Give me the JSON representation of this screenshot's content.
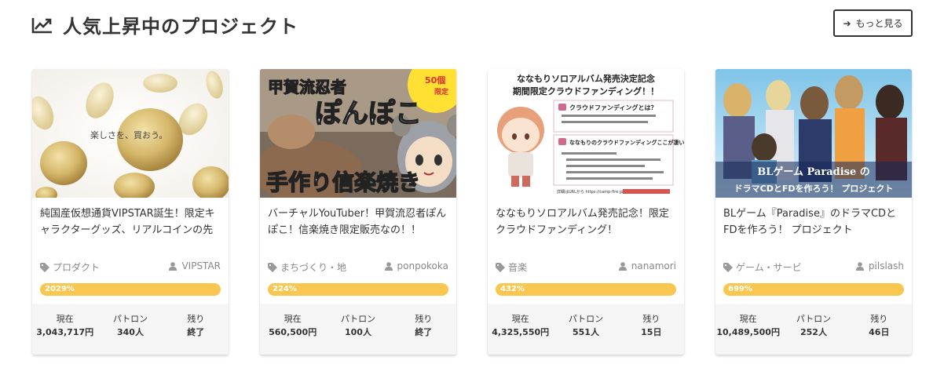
{
  "header": {
    "title": "人気上昇中のプロジェクト",
    "more_label": "もっと見る"
  },
  "labels": {
    "current": "現在",
    "patron": "パトロン",
    "remaining": "残り"
  },
  "projects": [
    {
      "image_text": "楽しさを、買おう。",
      "title": "純国産仮想通貨VIPSTAR誕生！限定キャラクターグッズ、リアルコインの先行販売",
      "category": "プロダクト",
      "owner": "VIPSTAR",
      "progress": "2029%",
      "current": "3,043,717円",
      "patrons": "340人",
      "remaining": "終了"
    },
    {
      "image_text": "甲賀流忍者ぽんぽこ手作り信楽焼き",
      "badge": "50個限定",
      "title": "バーチャルYouTuber！甲賀流忍者ぽんぽこ！信楽焼き限定販売なの！！",
      "category": "まちづくり・地",
      "owner": "ponpokoka",
      "progress": "224%",
      "current": "560,500円",
      "patrons": "100人",
      "remaining": "終了"
    },
    {
      "image_heading_1": "ななもりソロアルバム発売決定記念",
      "image_heading_2": "期間限定クラウドファンディング！！",
      "image_q1": "クラウドファンディングとは？",
      "image_q2": "ななもりのクラウドファンディングここが凄い！",
      "image_url": "詳細はURLから https://camp-fire.jp",
      "title": "ななもりソロアルバム発売記念！限定クラウドファンディング！",
      "category": "音楽",
      "owner": "nanamori",
      "progress": "432%",
      "current": "4,325,550円",
      "patrons": "551人",
      "remaining": "15日"
    },
    {
      "image_line_1": "BLゲーム Paradise の",
      "image_line_2": "ドラマCDとFDを作ろう！ プロジェクト",
      "title": "BLゲーム『Paradise』のドラマCDとFDを作ろう！ プロジェクト",
      "category": "ゲーム・サービ",
      "owner": "pilslash",
      "progress": "699%",
      "current": "10,489,500円",
      "patrons": "252人",
      "remaining": "46日"
    }
  ],
  "colors": {
    "progress": "#f9c74f",
    "stats_bg": "#f5f5f5",
    "text": "#333333",
    "meta": "#888888"
  },
  "icons": {
    "trend": "trending-up-icon",
    "more": "arrow-right-icon",
    "category": "tag-icon",
    "owner": "user-icon"
  }
}
